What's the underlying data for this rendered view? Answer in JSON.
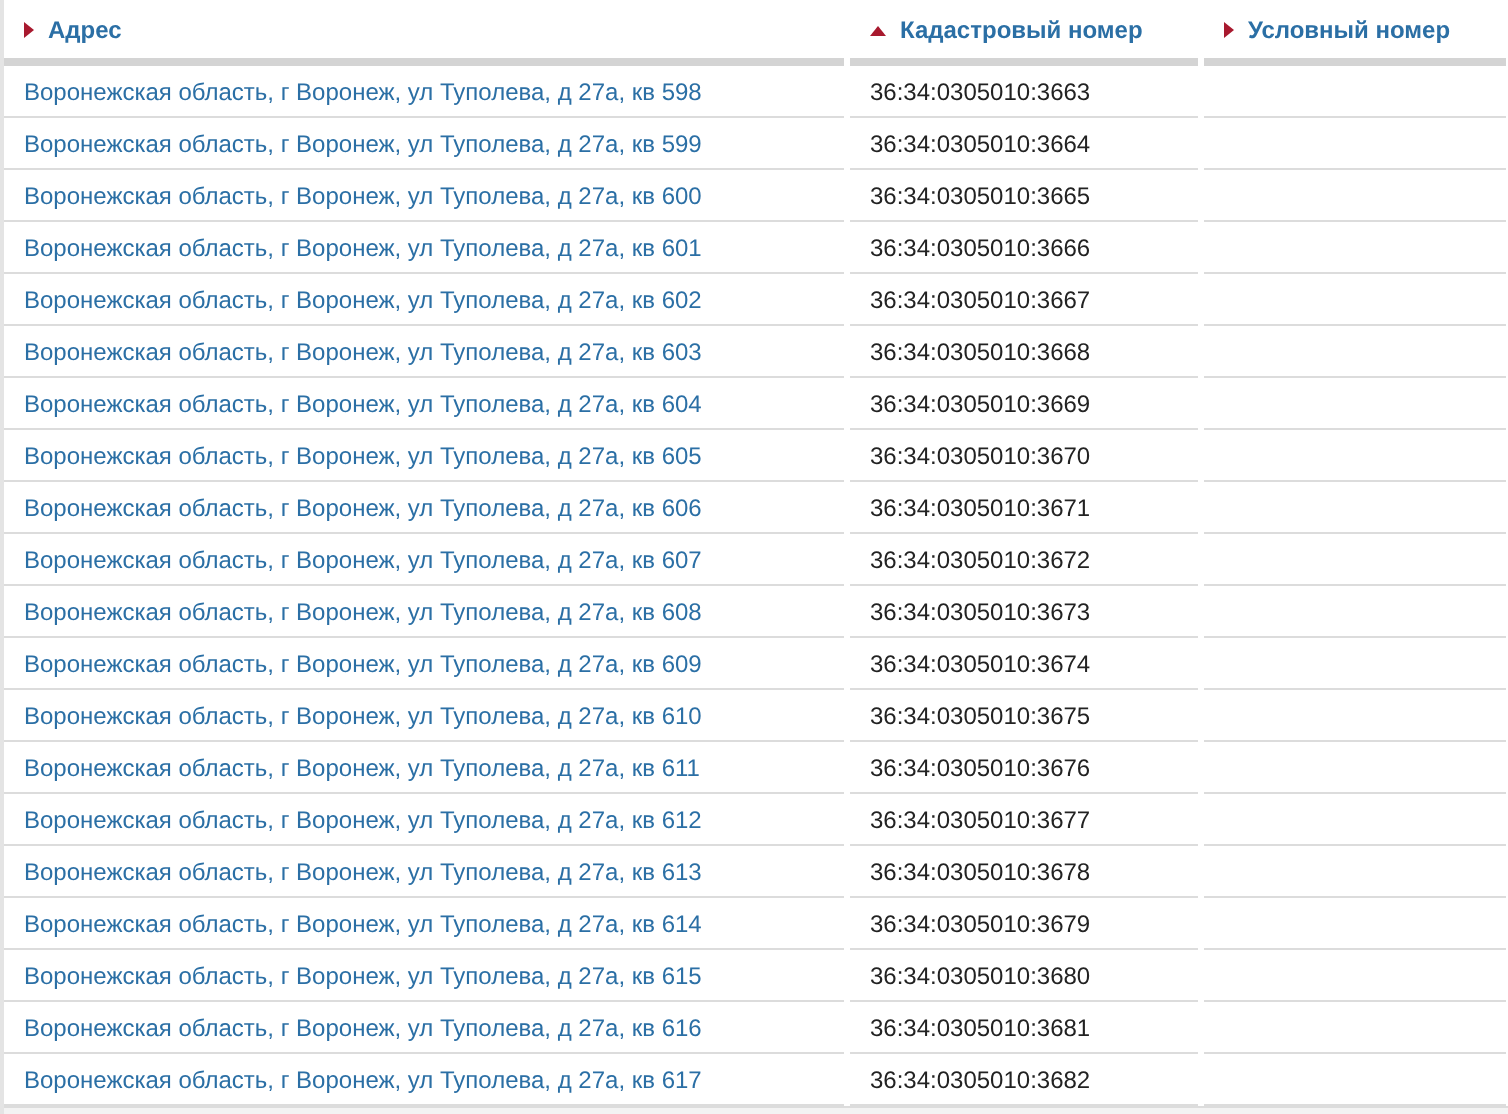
{
  "table": {
    "columns": [
      {
        "label": "Адрес",
        "sorted": false
      },
      {
        "label": "Кадастровый номер",
        "sorted": true
      },
      {
        "label": "Условный номер",
        "sorted": false
      }
    ],
    "rows": [
      {
        "address": "Воронежская область, г Воронеж, ул Туполева, д 27а, кв 598",
        "cadastral": "36:34:0305010:3663"
      },
      {
        "address": "Воронежская область, г Воронеж, ул Туполева, д 27а, кв 599",
        "cadastral": "36:34:0305010:3664"
      },
      {
        "address": "Воронежская область, г Воронеж, ул Туполева, д 27а, кв 600",
        "cadastral": "36:34:0305010:3665"
      },
      {
        "address": "Воронежская область, г Воронеж, ул Туполева, д 27а, кв 601",
        "cadastral": "36:34:0305010:3666"
      },
      {
        "address": "Воронежская область, г Воронеж, ул Туполева, д 27а, кв 602",
        "cadastral": "36:34:0305010:3667"
      },
      {
        "address": "Воронежская область, г Воронеж, ул Туполева, д 27а, кв 603",
        "cadastral": "36:34:0305010:3668"
      },
      {
        "address": "Воронежская область, г Воронеж, ул Туполева, д 27а, кв 604",
        "cadastral": "36:34:0305010:3669"
      },
      {
        "address": "Воронежская область, г Воронеж, ул Туполева, д 27а, кв 605",
        "cadastral": "36:34:0305010:3670"
      },
      {
        "address": "Воронежская область, г Воронеж, ул Туполева, д 27а, кв 606",
        "cadastral": "36:34:0305010:3671"
      },
      {
        "address": "Воронежская область, г Воронеж, ул Туполева, д 27а, кв 607",
        "cadastral": "36:34:0305010:3672"
      },
      {
        "address": "Воронежская область, г Воронеж, ул Туполева, д 27а, кв 608",
        "cadastral": "36:34:0305010:3673"
      },
      {
        "address": "Воронежская область, г Воронеж, ул Туполева, д 27а, кв 609",
        "cadastral": "36:34:0305010:3674"
      },
      {
        "address": "Воронежская область, г Воронеж, ул Туполева, д 27а, кв 610",
        "cadastral": "36:34:0305010:3675"
      },
      {
        "address": "Воронежская область, г Воронеж, ул Туполева, д 27а, кв 611",
        "cadastral": "36:34:0305010:3676"
      },
      {
        "address": "Воронежская область, г Воронеж, ул Туполева, д 27а, кв 612",
        "cadastral": "36:34:0305010:3677"
      },
      {
        "address": "Воронежская область, г Воронеж, ул Туполева, д 27а, кв 613",
        "cadastral": "36:34:0305010:3678"
      },
      {
        "address": "Воронежская область, г Воронеж, ул Туполева, д 27а, кв 614",
        "cadastral": "36:34:0305010:3679"
      },
      {
        "address": "Воронежская область, г Воронеж, ул Туполева, д 27а, кв 615",
        "cadastral": "36:34:0305010:3680"
      },
      {
        "address": "Воронежская область, г Воронеж, ул Туполева, д 27а, кв 616",
        "cadastral": "36:34:0305010:3681"
      },
      {
        "address": "Воронежская область, г Воронеж, ул Туполева, д 27а, кв 617",
        "cadastral": "36:34:0305010:3682"
      }
    ]
  }
}
